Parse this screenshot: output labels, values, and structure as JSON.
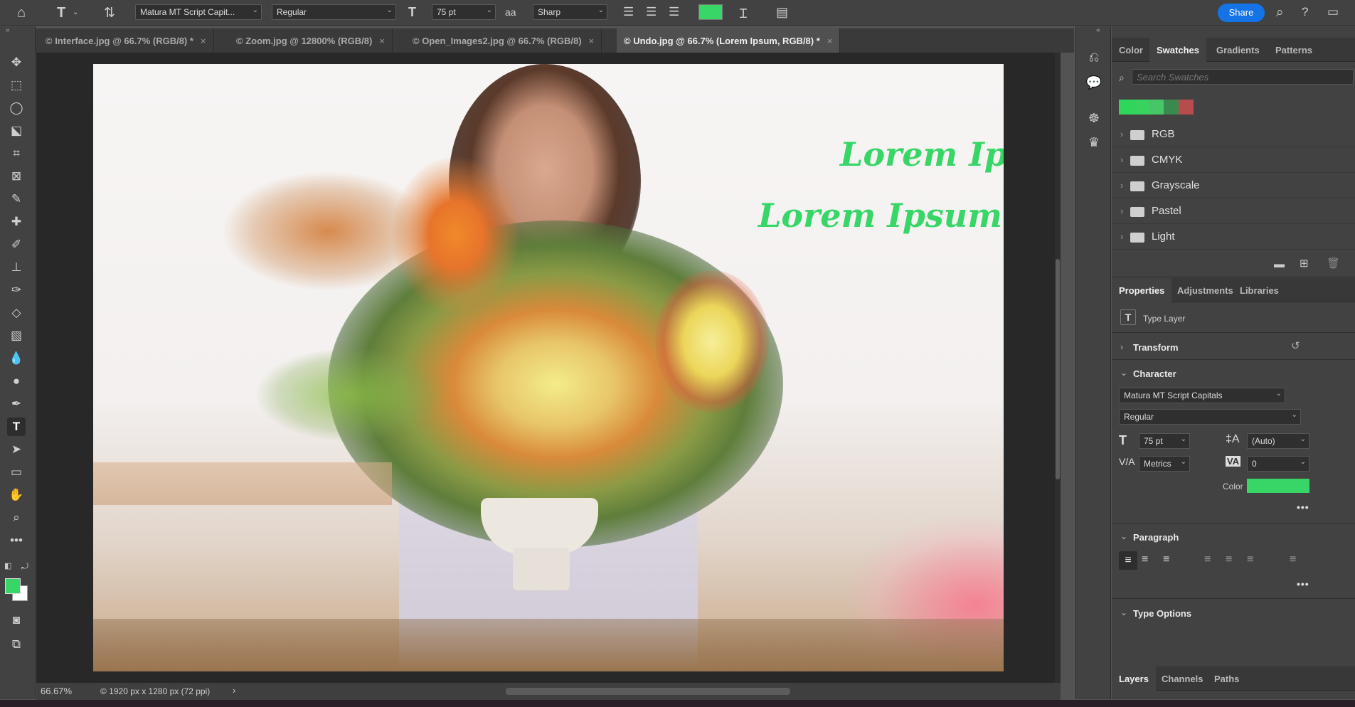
{
  "options_bar": {
    "font_family": "Matura MT Script Capit...",
    "font_style": "Regular",
    "font_size": "75 pt",
    "antialias_icon": "aa",
    "antialias": "Sharp",
    "text_color": "#37d667",
    "share_label": "Share"
  },
  "tabs": [
    {
      "label": "© Interface.jpg @ 66.7% (RGB/8) *",
      "close": "×"
    },
    {
      "label": "© Zoom.jpg @ 12800% (RGB/8)",
      "close": "×"
    },
    {
      "label": "© Open_Images2.jpg @ 66.7% (RGB/8)",
      "close": "×"
    },
    {
      "label": "© Undo.jpg @ 66.7% (Lorem Ipsum, RGB/8) *",
      "close": "×"
    }
  ],
  "canvas": {
    "text_line_1": "Lorem Ip",
    "text_line_2": "Lorem Ipsum",
    "text_color": "#37d667"
  },
  "status_bar": {
    "zoom": "66.67%",
    "doc_info": "© 1920 px x 1280 px (72 ppi)",
    "arrow": "›"
  },
  "swatches_panel": {
    "tabs": [
      "Color",
      "Swatches",
      "Gradients",
      "Patterns"
    ],
    "search_placeholder": "Search Swatches",
    "recent_colors": [
      "#2ed65a",
      "#38d35f",
      "#47c668",
      "#3a8a50",
      "#b84c4c"
    ],
    "groups": [
      "RGB",
      "CMYK",
      "Grayscale",
      "Pastel",
      "Light"
    ]
  },
  "properties_panel": {
    "tabs": [
      "Properties",
      "Adjustments",
      "Libraries"
    ],
    "layer_type": "Type Layer",
    "transform_label": "Transform",
    "character_label": "Character",
    "font_family": "Matura MT Script Capitals",
    "font_style": "Regular",
    "font_size": "75 pt",
    "leading": "(Auto)",
    "kerning": "Metrics",
    "tracking": "0",
    "color_label": "Color",
    "color": "#37d667",
    "more": "•••",
    "paragraph_label": "Paragraph",
    "type_options_label": "Type Options"
  },
  "layers_panel": {
    "tabs": [
      "Layers",
      "Channels",
      "Paths"
    ]
  }
}
